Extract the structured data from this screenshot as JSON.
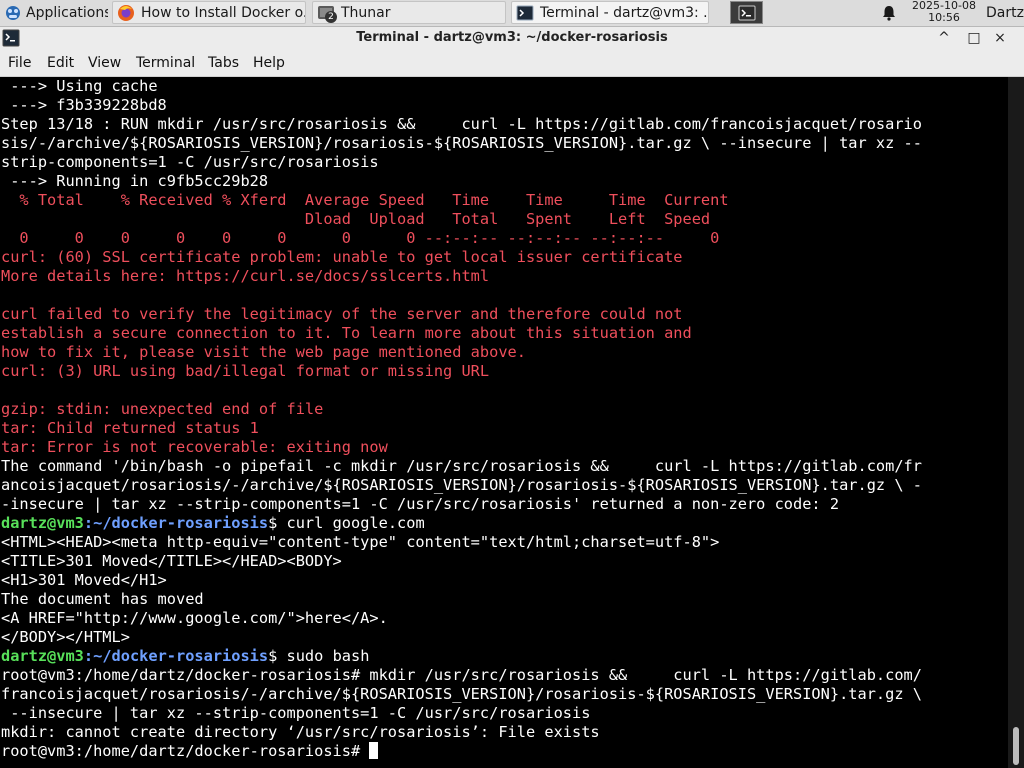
{
  "panel": {
    "applications_label": "Applications",
    "tasks": [
      {
        "label": "How to Install Docker o..."
      },
      {
        "label": "Thunar",
        "badge": "2"
      },
      {
        "label": "Terminal - dartz@vm3: ..."
      }
    ],
    "clock_date": "2025-10-08",
    "clock_time": "10:56",
    "user": "Dartz"
  },
  "window": {
    "title": "Terminal - dartz@vm3: ~/docker-rosariosis",
    "controls": {
      "collapse": "^",
      "maximize": "□",
      "close": "×"
    }
  },
  "menubar": {
    "items": [
      "File",
      "Edit",
      "View",
      "Terminal",
      "Tabs",
      "Help"
    ]
  },
  "terminal": {
    "lines": [
      {
        "text": " ---> Using cache"
      },
      {
        "text": " ---> f3b339228bd8"
      },
      {
        "text": "Step 13/18 : RUN mkdir /usr/src/rosariosis &&     curl -L https://gitlab.com/francoisjacquet/rosario"
      },
      {
        "text": "sis/-/archive/${ROSARIOSIS_VERSION}/rosariosis-${ROSARIOSIS_VERSION}.tar.gz \\ --insecure | tar xz --"
      },
      {
        "text": "strip-components=1 -C /usr/src/rosariosis"
      },
      {
        "text": " ---> Running in c9fb5cc29b28"
      },
      {
        "text": "  % Total    % Received % Xferd  Average Speed   Time    Time     Time  Current",
        "style": "red"
      },
      {
        "text": "                                 Dload  Upload   Total   Spent    Left  Speed",
        "style": "red"
      },
      {
        "text": "  0     0    0     0    0     0      0      0 --:--:-- --:--:-- --:--:--     0",
        "style": "red"
      },
      {
        "text": "curl: (60) SSL certificate problem: unable to get local issuer certificate",
        "style": "red"
      },
      {
        "text": "More details here: https://curl.se/docs/sslcerts.html",
        "style": "red"
      },
      {
        "text": ""
      },
      {
        "text": "curl failed to verify the legitimacy of the server and therefore could not",
        "style": "red"
      },
      {
        "text": "establish a secure connection to it. To learn more about this situation and",
        "style": "red"
      },
      {
        "text": "how to fix it, please visit the web page mentioned above.",
        "style": "red"
      },
      {
        "text": "curl: (3) URL using bad/illegal format or missing URL",
        "style": "red"
      },
      {
        "text": ""
      },
      {
        "text": "gzip: stdin: unexpected end of file",
        "style": "red"
      },
      {
        "text": "tar: Child returned status 1",
        "style": "red"
      },
      {
        "text": "tar: Error is not recoverable: exiting now",
        "style": "red"
      },
      {
        "text": "The command '/bin/bash -o pipefail -c mkdir /usr/src/rosariosis &&     curl -L https://gitlab.com/fr"
      },
      {
        "text": "ancoisjacquet/rosariosis/-/archive/${ROSARIOSIS_VERSION}/rosariosis-${ROSARIOSIS_VERSION}.tar.gz \\ -"
      },
      {
        "text": "-insecure | tar xz --strip-components=1 -C /usr/src/rosariosis' returned a non-zero code: 2"
      },
      {
        "prompt_user": "dartz@vm3",
        "prompt_sep": ":",
        "prompt_path": "~/docker-rosariosis",
        "prompt_end": "$ ",
        "text": "curl google.com"
      },
      {
        "text": "<HTML><HEAD><meta http-equiv=\"content-type\" content=\"text/html;charset=utf-8\">"
      },
      {
        "text": "<TITLE>301 Moved</TITLE></HEAD><BODY>"
      },
      {
        "text": "<H1>301 Moved</H1>"
      },
      {
        "text": "The document has moved"
      },
      {
        "text": "<A HREF=\"http://www.google.com/\">here</A>."
      },
      {
        "text": "</BODY></HTML>"
      },
      {
        "prompt_user": "dartz@vm3",
        "prompt_sep": ":",
        "prompt_path": "~/docker-rosariosis",
        "prompt_end": "$ ",
        "text": "sudo bash"
      },
      {
        "text": "root@vm3:/home/dartz/docker-rosariosis# mkdir /usr/src/rosariosis &&     curl -L https://gitlab.com/"
      },
      {
        "text": "francoisjacquet/rosariosis/-/archive/${ROSARIOSIS_VERSION}/rosariosis-${ROSARIOSIS_VERSION}.tar.gz \\"
      },
      {
        "text": " --insecure | tar xz --strip-components=1 -C /usr/src/rosariosis"
      },
      {
        "text": "mkdir: cannot create directory ‘/usr/src/rosariosis’: File exists"
      },
      {
        "text": "root@vm3:/home/dartz/docker-rosariosis# ",
        "cursor": true
      }
    ]
  },
  "colors": {
    "error": "#ef4f5c",
    "prompt_user": "#58e05a",
    "prompt_path": "#6fa0ff",
    "text": "#ffffff",
    "background": "#000000"
  }
}
